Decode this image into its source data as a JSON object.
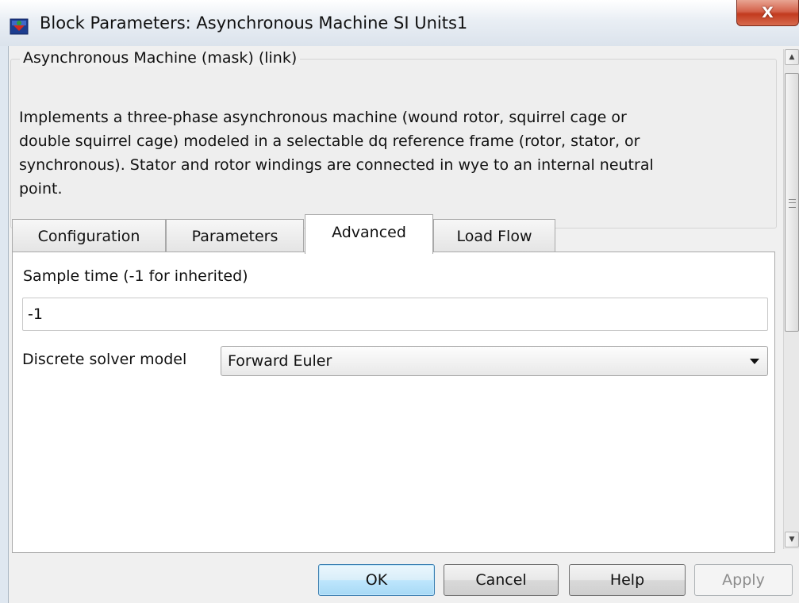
{
  "window": {
    "title": "Block Parameters: Asynchronous Machine SI Units1",
    "close_glyph": "X",
    "icon": "simulink-block-icon"
  },
  "description": {
    "legend": "Asynchronous Machine (mask) (link)",
    "text": "Implements a three-phase asynchronous machine (wound rotor, squirrel cage or\ndouble squirrel cage) modeled in a selectable dq reference frame (rotor, stator, or\nsynchronous). Stator and rotor windings are connected in wye to an internal neutral\npoint."
  },
  "tabs": [
    {
      "label": "Configuration",
      "active": false
    },
    {
      "label": "Parameters",
      "active": false
    },
    {
      "label": "Advanced",
      "active": true
    },
    {
      "label": "Load Flow",
      "active": false
    }
  ],
  "advanced": {
    "sample_time_label": "Sample time (-1 for inherited)",
    "sample_time_value": "-1",
    "solver_label": "Discrete solver model",
    "solver_value": "Forward Euler"
  },
  "buttons": {
    "ok": "OK",
    "cancel": "Cancel",
    "help": "Help",
    "apply": "Apply"
  },
  "scrollbar": {
    "up_glyph": "▲",
    "down_glyph": "▼"
  }
}
